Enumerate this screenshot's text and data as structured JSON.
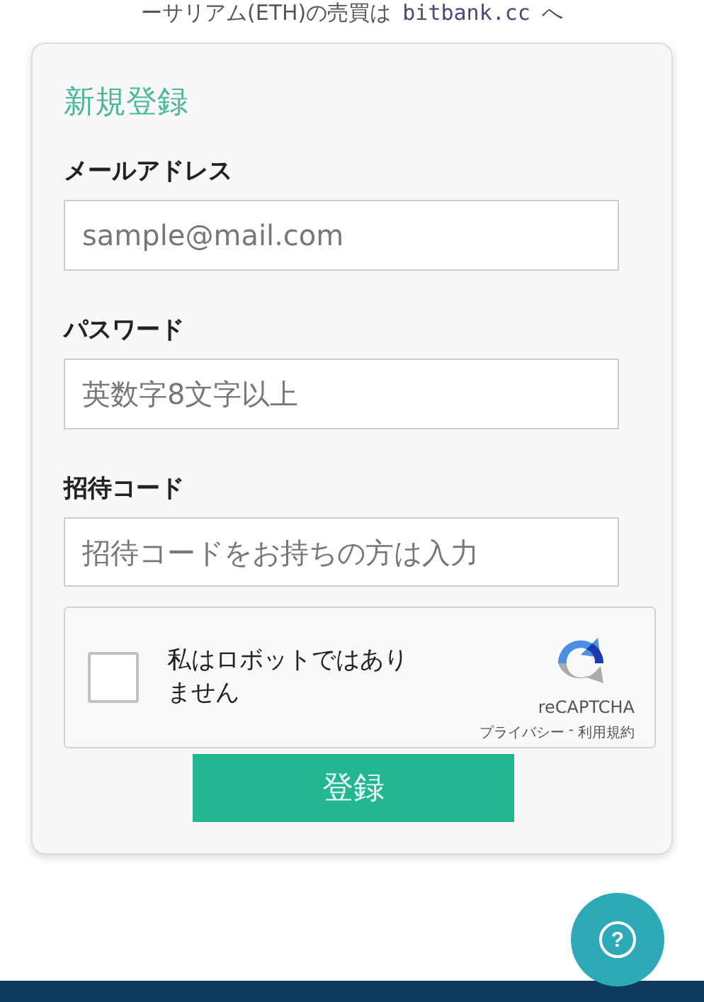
{
  "banner": {
    "text": "ーサリアム(ETH)の売買は",
    "link": "bitbank.cc",
    "suffix": "へ"
  },
  "form": {
    "title": "新規登録",
    "fields": [
      {
        "label": "メールアドレス",
        "placeholder": "sample@mail.com"
      },
      {
        "label": "パスワード",
        "placeholder": "英数字8文字以上"
      },
      {
        "label": "招待コード",
        "placeholder": "招待コードをお持ちの方は入力"
      }
    ],
    "captcha": {
      "checked": false,
      "label": "私はロボットではありません",
      "brand": "reCAPTCHA",
      "privacy": "プライバシー",
      "separator": "-",
      "terms": "利用規約"
    },
    "submit": "登録"
  },
  "help_button": {
    "label": "?"
  }
}
